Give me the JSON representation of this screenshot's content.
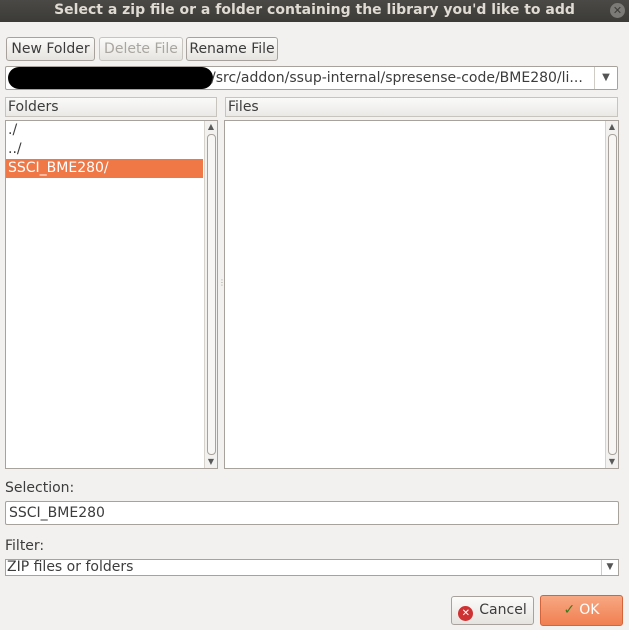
{
  "window": {
    "title": "Select a zip file or a folder containing the library you'd like to add"
  },
  "toolbar": {
    "new_folder": "New Folder",
    "delete_file": "Delete File",
    "rename_file": "Rename File"
  },
  "path": {
    "value": "/src/addon/ssup-internal/spresense-code/BME280/li..."
  },
  "folders": {
    "header": "Folders",
    "items": [
      {
        "label": "./",
        "selected": false
      },
      {
        "label": "../",
        "selected": false
      },
      {
        "label": "SSCI_BME280/",
        "selected": true
      }
    ]
  },
  "files": {
    "header": "Files",
    "items": []
  },
  "selection": {
    "label": "Selection:",
    "value": "SSCI_BME280"
  },
  "filter": {
    "label": "Filter:",
    "value": "ZIP files or folders"
  },
  "buttons": {
    "cancel": "Cancel",
    "ok": "OK"
  },
  "colors": {
    "selection_highlight": "#f07746",
    "ok_button": "#f07f51"
  }
}
